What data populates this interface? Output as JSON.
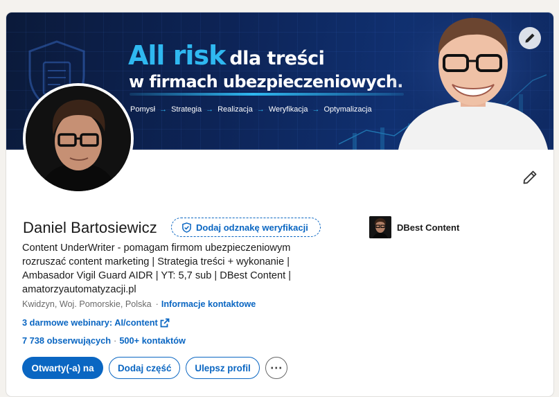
{
  "banner": {
    "headline_accent": "All risk",
    "headline_rest": "dla treści",
    "headline_line2": "w firmach ubezpieczeniowych.",
    "steps": [
      "Pomysł",
      "Strategia",
      "Realizacja",
      "Weryfikacja",
      "Optymalizacja"
    ]
  },
  "profile": {
    "name": "Daniel Bartosiewicz",
    "verify_badge": "Dodaj odznakę weryfikacji",
    "headline": "Content UnderWriter - pomagam firmom ubezpieczeniowym rozruszać content marketing | Strategia treści + wykonanie | Ambasador Vigil Guard AIDR | YT: 5,7 sub | DBest Content | amatorzyautomatyzacji.pl",
    "location": "Kwidzyn, Woj. Pomorskie, Polska",
    "location_sep": "·",
    "contact_info": "Informacje kontaktowe",
    "webinar_link": "3 darmowe webinary: AI/content",
    "followers": "7 738 obserwujących",
    "stats_sep": "·",
    "connections": "500+ kontaktów"
  },
  "company": {
    "name": "DBest Content"
  },
  "buttons": {
    "open_to": "Otwarty(-a) na",
    "add_section": "Dodaj część",
    "improve_profile": "Ulepsz profil",
    "more": "⋯"
  },
  "colors": {
    "brand_blue": "#0a66c2",
    "banner_accent": "#2fb8f0",
    "banner_bg": "#0d2457"
  },
  "icons": [
    "pencil-icon",
    "shield-check-icon",
    "external-link-icon",
    "more-icon"
  ]
}
